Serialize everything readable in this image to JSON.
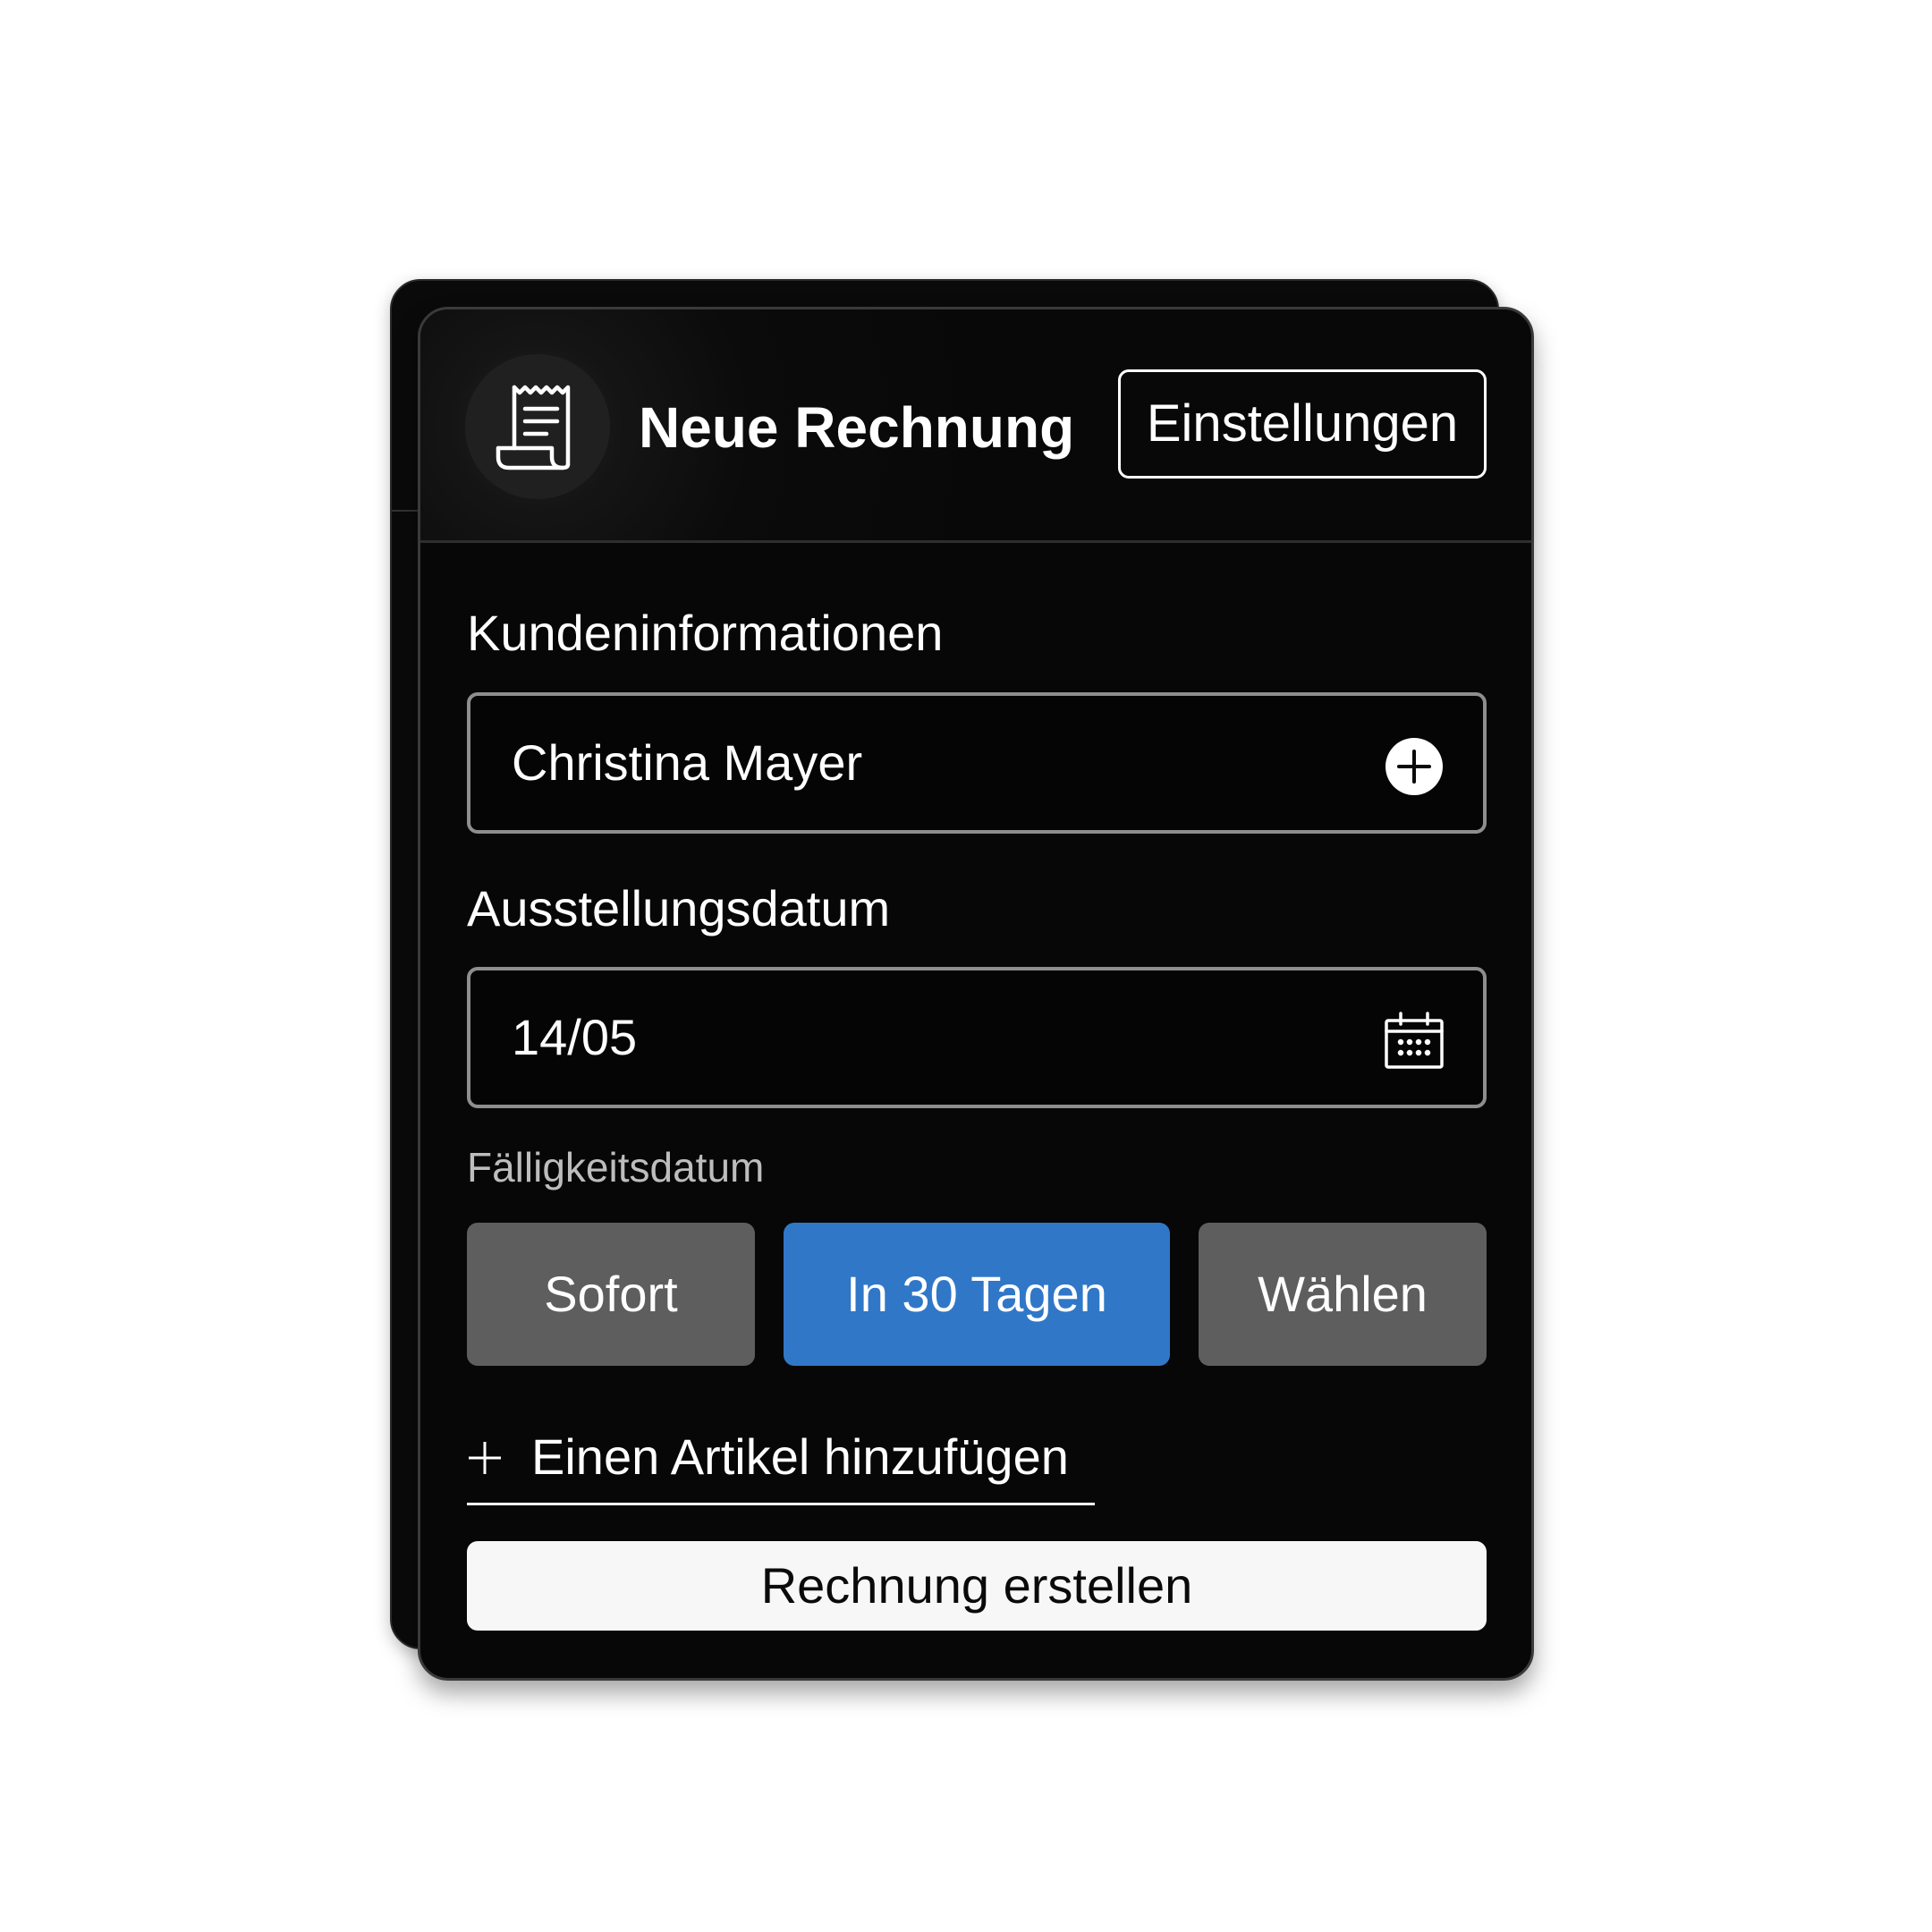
{
  "header": {
    "icon": "receipt-icon",
    "title": "Neue Rechnung",
    "settings_label": "Einstellungen"
  },
  "customer": {
    "label": "Kundeninformationen",
    "value": "Christina Mayer",
    "action_icon": "plus-circle-icon"
  },
  "issue_date": {
    "label": "Ausstellungsdatum",
    "value": "14/05",
    "action_icon": "calendar-icon"
  },
  "due_date": {
    "label": "Fälligkeitsdatum",
    "options": [
      {
        "label": "Sofort",
        "selected": false
      },
      {
        "label": "In 30 Tagen",
        "selected": true
      },
      {
        "label": "Wählen",
        "selected": false
      }
    ]
  },
  "add_item": {
    "icon": "plus-icon",
    "label": "Einen Artikel hinzufügen"
  },
  "submit": {
    "label": "Rechnung erstellen"
  },
  "colors": {
    "card_background": "#070707",
    "selected_option": "#3077c8",
    "unselected_option": "#5e5e5e",
    "primary_button": "#f7f7f7"
  }
}
